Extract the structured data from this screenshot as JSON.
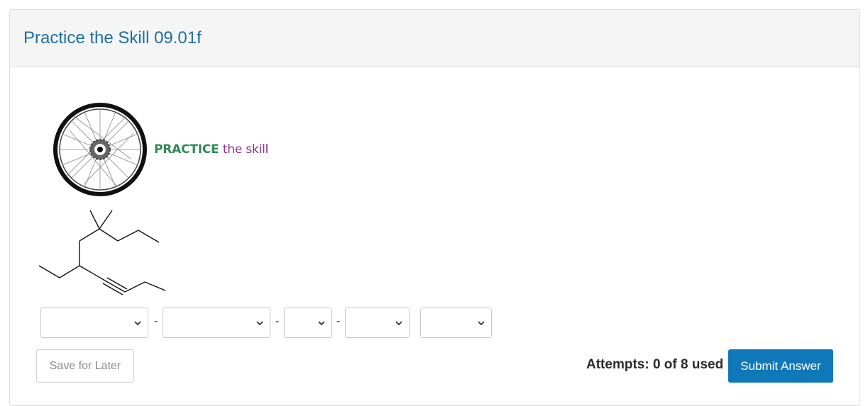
{
  "header": {
    "title": "Practice the Skill 09.01f"
  },
  "practice_banner": {
    "word1": "PRACTICE",
    "word2": "the skill",
    "icon": "bicycle-wheel-icon"
  },
  "molecule": {
    "icon": "skeletal-structure-diagram"
  },
  "name_selects": [
    {
      "value": ""
    },
    {
      "value": ""
    },
    {
      "value": ""
    },
    {
      "value": ""
    },
    {
      "value": ""
    }
  ],
  "separators": [
    "-",
    "-",
    "-"
  ],
  "footer": {
    "save_label": "Save for Later",
    "attempts_text": "Attempts: 0 of 8 used",
    "submit_label": "Submit Answer"
  },
  "colors": {
    "title": "#1d6fa5",
    "practice_word": "#2e8b57",
    "skill_word": "#8b2b8b",
    "submit_bg": "#0f78b8"
  }
}
